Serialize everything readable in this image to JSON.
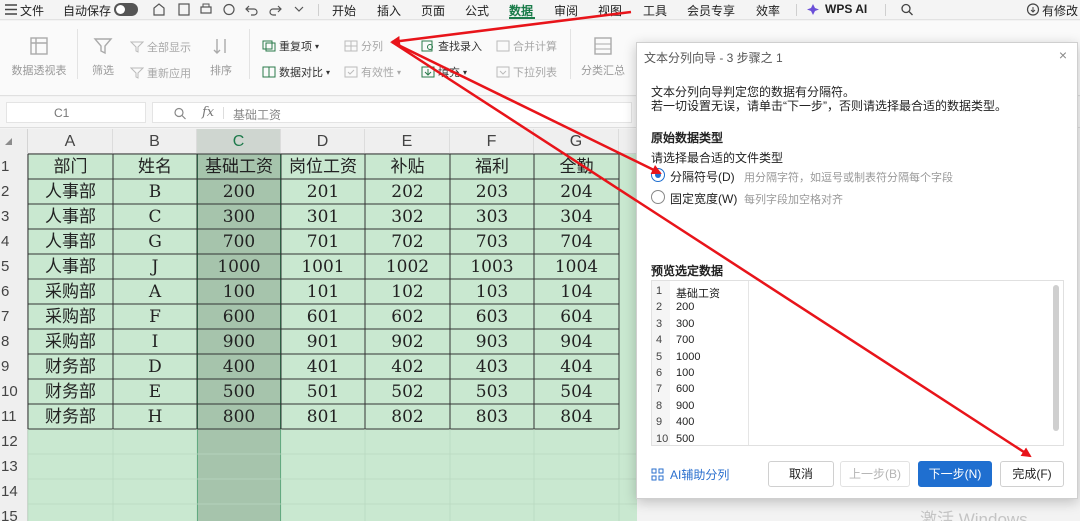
{
  "menubar": {
    "file": "文件",
    "autosave": "自动保存",
    "tabs": [
      "开始",
      "插入",
      "页面",
      "公式",
      "数据",
      "审阅",
      "视图",
      "工具",
      "会员专享",
      "效率"
    ],
    "active_tab": "数据",
    "wps_ai": "WPS AI",
    "modified": "有修改"
  },
  "ribbon": {
    "pivot": "数据透视表",
    "filter": "筛选",
    "show_all": "全部显示",
    "reapply": "重新应用",
    "sort": "排序",
    "duplicates": "重复项",
    "compare": "数据对比",
    "split": "分列",
    "validity": "有效性",
    "find_entry": "查找录入",
    "fill": "填充",
    "merge_calc": "合并计算",
    "dropdown": "下拉列表",
    "subtotal": "分类汇总"
  },
  "formula_bar": {
    "cell_ref": "C1",
    "fx": "fx",
    "value": "基础工资"
  },
  "sheet": {
    "columns": [
      "A",
      "B",
      "C",
      "D",
      "E",
      "F",
      "G"
    ],
    "row_numbers": [
      "1",
      "2",
      "3",
      "4",
      "5",
      "6",
      "7",
      "8",
      "9",
      "10",
      "11",
      "12",
      "13",
      "14",
      "15"
    ],
    "rows": [
      [
        "部门",
        "姓名",
        "基础工资",
        "岗位工资",
        "补贴",
        "福利",
        "全勤"
      ],
      [
        "人事部",
        "B",
        "200",
        "201",
        "202",
        "203",
        "204"
      ],
      [
        "人事部",
        "C",
        "300",
        "301",
        "302",
        "303",
        "304"
      ],
      [
        "人事部",
        "G",
        "700",
        "701",
        "702",
        "703",
        "704"
      ],
      [
        "人事部",
        "J",
        "1000",
        "1001",
        "1002",
        "1003",
        "1004"
      ],
      [
        "采购部",
        "A",
        "100",
        "101",
        "102",
        "103",
        "104"
      ],
      [
        "采购部",
        "F",
        "600",
        "601",
        "602",
        "603",
        "604"
      ],
      [
        "采购部",
        "I",
        "900",
        "901",
        "902",
        "903",
        "904"
      ],
      [
        "财务部",
        "D",
        "400",
        "401",
        "402",
        "403",
        "404"
      ],
      [
        "财务部",
        "E",
        "500",
        "501",
        "502",
        "503",
        "504"
      ],
      [
        "财务部",
        "H",
        "800",
        "801",
        "802",
        "803",
        "804"
      ]
    ]
  },
  "dialog": {
    "title": "文本分列向导 - 3 步骤之 1",
    "close": "×",
    "intro1": "文本分列向导判定您的数据有分隔符。",
    "intro2": "若一切设置无误，请单击“下一步”，否则请选择最合适的数据类型。",
    "section": "原始数据类型",
    "subsection": "请选择最合适的文件类型",
    "option_delimited": "分隔符号(D)",
    "option_delimited_hint": "用分隔字符，如逗号或制表符分隔每个字段",
    "option_fixed": "固定宽度(W)",
    "option_fixed_hint": "每列字段加空格对齐",
    "preview_label": "预览选定数据",
    "preview_numbers": [
      "1",
      "2",
      "3",
      "4",
      "5",
      "6",
      "7",
      "8",
      "9",
      "10"
    ],
    "preview_values": [
      "基础工资",
      "200",
      "300",
      "700",
      "1000",
      "100",
      "600",
      "900",
      "400",
      "500"
    ],
    "ai_split": "AI辅助分列",
    "cancel": "取消",
    "prev": "上一步(B)",
    "next": "下一步(N)",
    "finish": "完成(F)"
  },
  "watermark": "激活 Windows",
  "colors": {
    "accent_green": "#1b7c4a",
    "sheet_green": "#c9e8d0",
    "primary_blue": "#1f6fd0",
    "arrow_red": "#e8141a"
  }
}
